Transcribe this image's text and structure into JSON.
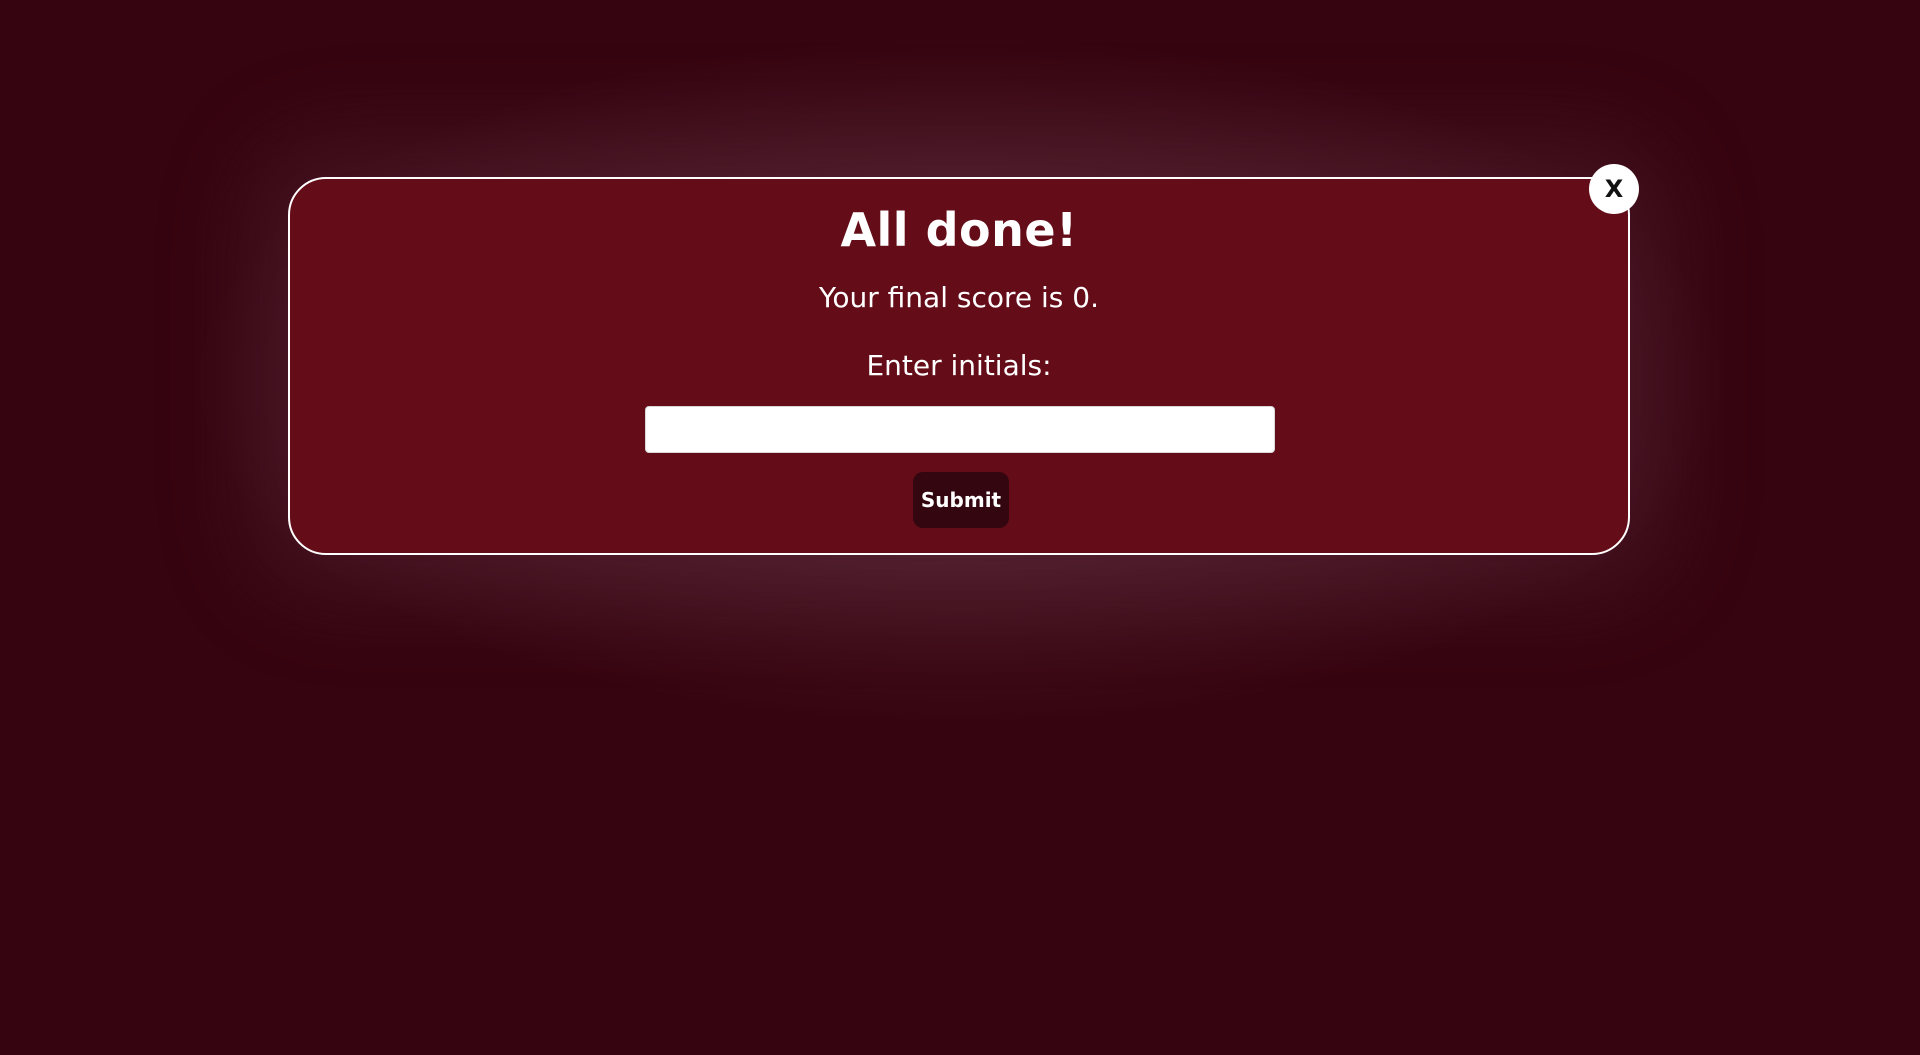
{
  "modal": {
    "title": "All done!",
    "score_text": "Your final score is 0.",
    "initials_label": "Enter initials:",
    "initials_value": "",
    "initials_placeholder": "",
    "submit_label": "Submit",
    "close_label": "X"
  },
  "colors": {
    "background": "#360410",
    "modal_background": "#640d18",
    "modal_border": "#ffffff",
    "submit_background": "#330610",
    "text": "#ffffff"
  }
}
